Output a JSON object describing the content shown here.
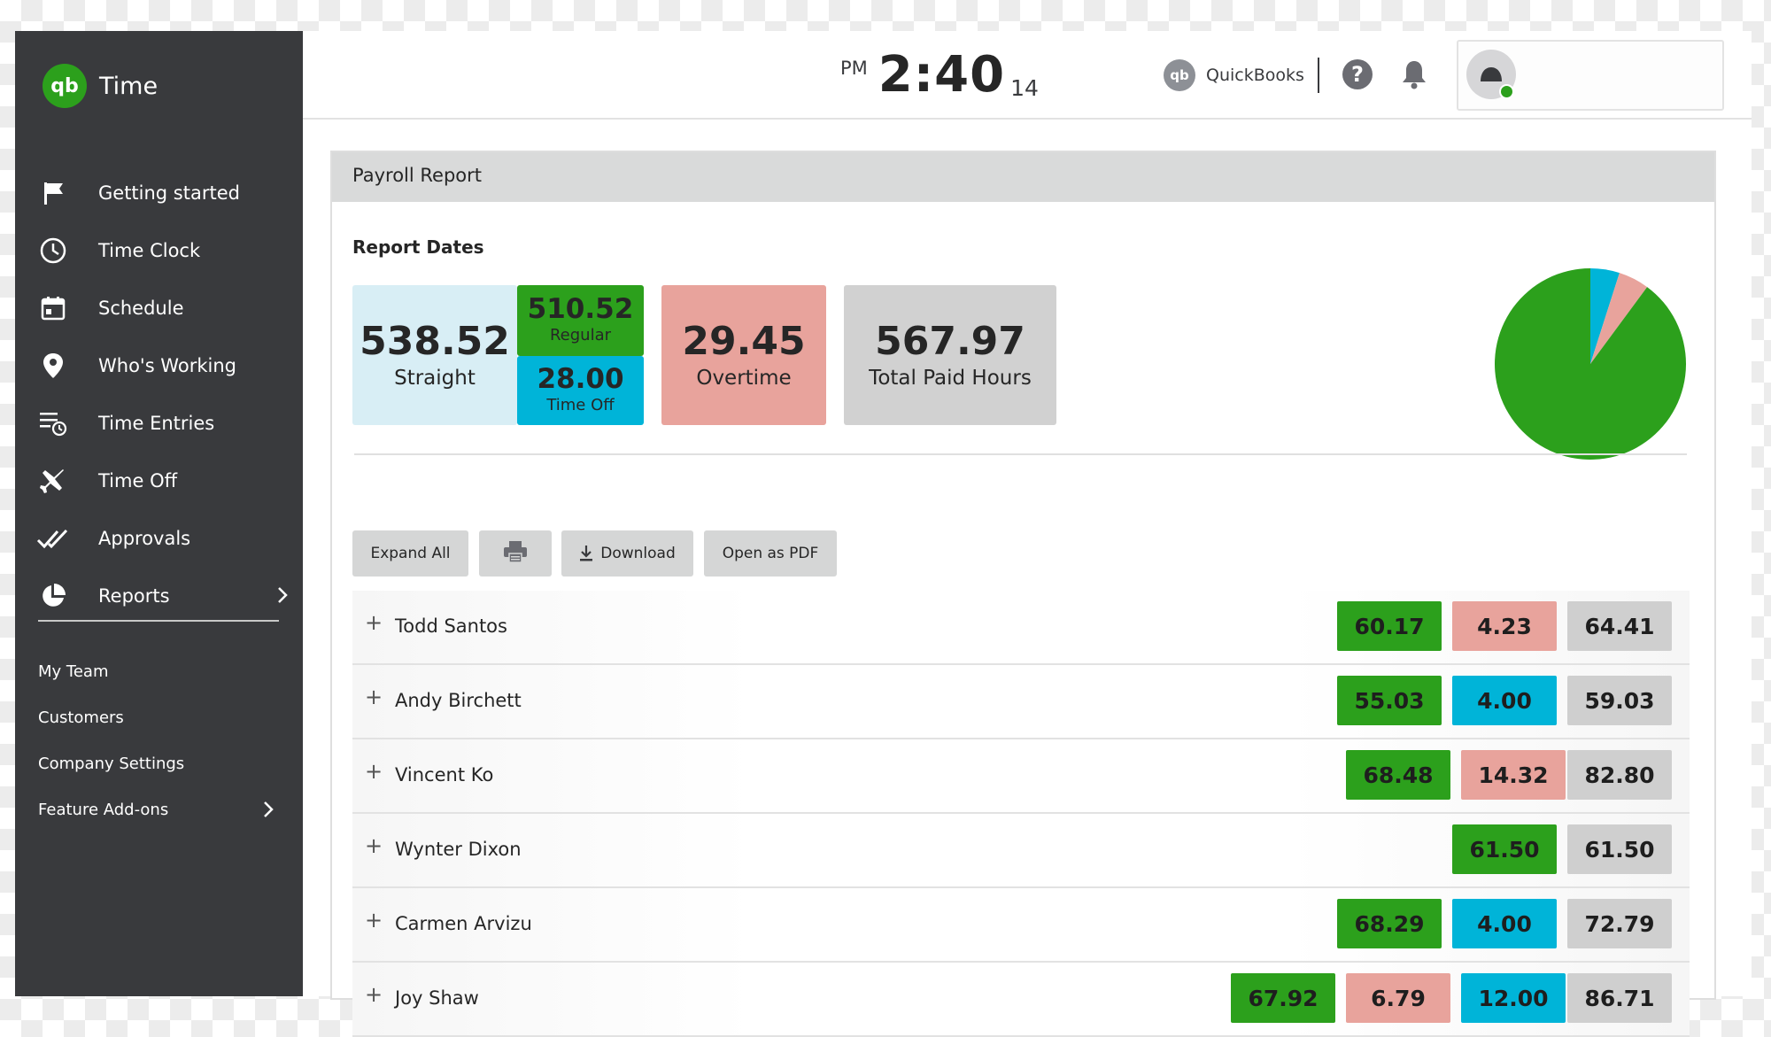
{
  "app": {
    "name": "Time",
    "logo_text": "qb"
  },
  "sidebar": {
    "items": [
      {
        "label": "Getting started",
        "icon": "flag-icon"
      },
      {
        "label": "Time Clock",
        "icon": "clock-icon"
      },
      {
        "label": "Schedule",
        "icon": "calendar-icon"
      },
      {
        "label": "Who's Working",
        "icon": "location-pin-icon"
      },
      {
        "label": "Time Entries",
        "icon": "time-entries-icon"
      },
      {
        "label": "Time Off",
        "icon": "airplane-icon"
      },
      {
        "label": "Approvals",
        "icon": "double-check-icon"
      },
      {
        "label": "Reports",
        "icon": "pie-chart-icon"
      }
    ],
    "secondary": [
      {
        "label": "My Team"
      },
      {
        "label": "Customers"
      },
      {
        "label": "Company Settings"
      },
      {
        "label": "Feature Add-ons"
      }
    ]
  },
  "header": {
    "ampm": "PM",
    "time": "2:40",
    "seconds": "14",
    "quickbooks_label": "QuickBooks",
    "help_label": "?"
  },
  "panel": {
    "title": "Payroll Report",
    "section_title": "Report Dates"
  },
  "summary": {
    "straight": {
      "value": "538.52",
      "label": "Straight"
    },
    "regular": {
      "value": "510.52",
      "label": "Regular"
    },
    "time_off": {
      "value": "28.00",
      "label": "Time Off"
    },
    "overtime": {
      "value": "29.45",
      "label": "Overtime"
    },
    "total_paid": {
      "value": "567.97",
      "label": "Total Paid Hours"
    }
  },
  "pie": {
    "slices": [
      {
        "name": "Regular",
        "value": 510.52,
        "color": "#2ca01c"
      },
      {
        "name": "Time Off",
        "value": 28.0,
        "color": "#00b4d8"
      },
      {
        "name": "Overtime",
        "value": 29.45,
        "color": "#e8a39c"
      }
    ]
  },
  "toolbar": {
    "expand_all": "Expand All",
    "download": "Download",
    "open_pdf": "Open as PDF"
  },
  "colors": {
    "regular": "#2ca01c",
    "overtime": "#e8a39c",
    "time_off": "#00b4d8",
    "total": "#cfcfcf",
    "sidebar": "#393a3d"
  },
  "employees": [
    {
      "name": "Todd Santos",
      "regular": "60.17",
      "overtime": "4.23",
      "time_off": "",
      "total": "64.41"
    },
    {
      "name": "Andy Birchett",
      "regular": "55.03",
      "overtime": "",
      "time_off": "4.00",
      "total": "59.03"
    },
    {
      "name": "Vincent Ko",
      "regular": "68.48",
      "overtime": "14.32",
      "time_off": "",
      "total": "82.80"
    },
    {
      "name": "Wynter Dixon",
      "regular": "61.50",
      "overtime": "",
      "time_off": "",
      "total": "61.50"
    },
    {
      "name": "Carmen Arvizu",
      "regular": "68.29",
      "overtime": "",
      "time_off": "4.00",
      "total": "72.79"
    },
    {
      "name": "Joy Shaw",
      "regular": "67.92",
      "overtime": "6.79",
      "time_off": "12.00",
      "total": "86.71"
    }
  ]
}
